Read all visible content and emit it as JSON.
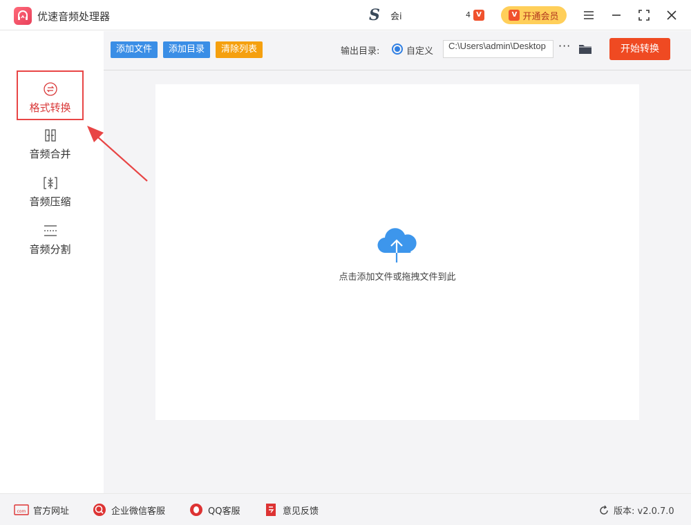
{
  "app": {
    "title": "优速音频处理器"
  },
  "header": {
    "user_name": "会i",
    "message_count": "4",
    "vip_button_label": "开通会员",
    "vip_mark": "V"
  },
  "sidebar": {
    "items": [
      {
        "label": "格式转换",
        "icon": "format-convert-icon",
        "active": true
      },
      {
        "label": "音频合并",
        "icon": "merge-icon",
        "active": false
      },
      {
        "label": "音频压缩",
        "icon": "compress-icon",
        "active": false
      },
      {
        "label": "音频分割",
        "icon": "split-icon",
        "active": false
      }
    ]
  },
  "toolbar": {
    "add_file": "添加文件",
    "add_folder": "添加目录",
    "clear_list": "清除列表",
    "output_label": "输出目录:",
    "radio_label": "自定义",
    "output_path": "C:\\Users\\admin\\Desktop",
    "more": "···",
    "start": "开始转换"
  },
  "dropzone": {
    "hint": "点击添加文件或拖拽文件到此"
  },
  "footer": {
    "links": [
      {
        "label": "官方网址",
        "icon": "website-icon"
      },
      {
        "label": "企业微信客服",
        "icon": "wechat-service-icon"
      },
      {
        "label": "QQ客服",
        "icon": "qq-icon"
      },
      {
        "label": "意见反馈",
        "icon": "feedback-icon"
      }
    ],
    "version": "版本: v2.0.7.0"
  },
  "colors": {
    "accent_blue": "#3a8ee6",
    "accent_orange": "#f5a00f",
    "start_red": "#ef4a22",
    "active_red": "#e84545",
    "vip_yellow": "#ffcf5a"
  }
}
